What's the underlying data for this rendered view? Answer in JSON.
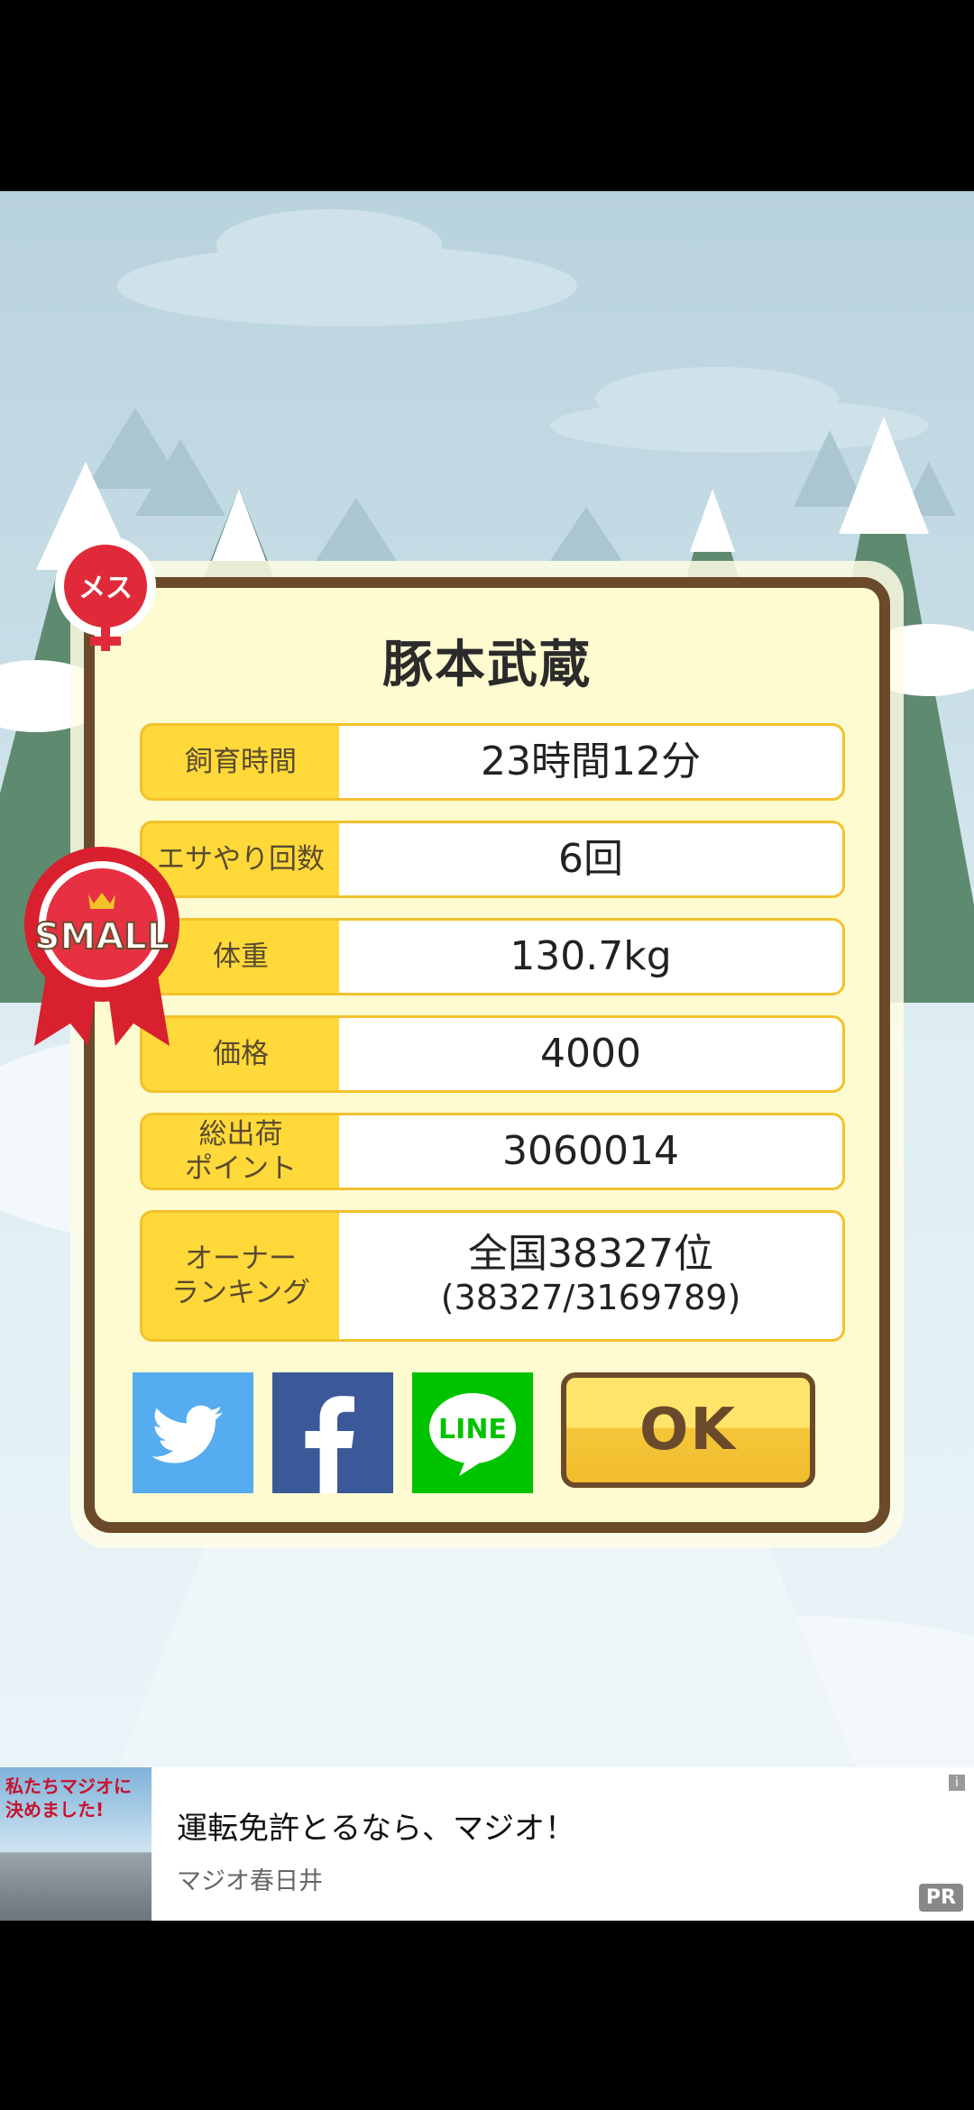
{
  "badges": {
    "gender": "メス",
    "size": "SMALL"
  },
  "pig_name": "豚本武蔵",
  "stats": [
    {
      "label": "飼育時間",
      "value": "23時間12分"
    },
    {
      "label": "エサやり回数",
      "value": "6回"
    },
    {
      "label": "体重",
      "value": "130.7kg"
    },
    {
      "label": "価格",
      "value": "4000"
    },
    {
      "label": "総出荷\nポイント",
      "value": "3060014"
    },
    {
      "label": "オーナー\nランキング",
      "value": "全国38327位",
      "sub": "(38327/3169789)"
    }
  ],
  "share": {
    "line_label": "LINE"
  },
  "ok_label": "OK",
  "ad": {
    "title": "運転免許とるなら、マジオ！",
    "sponsor": "マジオ春日井",
    "pr_label": "PR",
    "info_label": "i",
    "image_text": "私たちマジオに決めました!"
  },
  "colors": {
    "twitter": "#55acee",
    "facebook": "#3b5998",
    "line": "#00c300",
    "frame": "#6b4a2b",
    "label_bg": "#ffd93a"
  }
}
